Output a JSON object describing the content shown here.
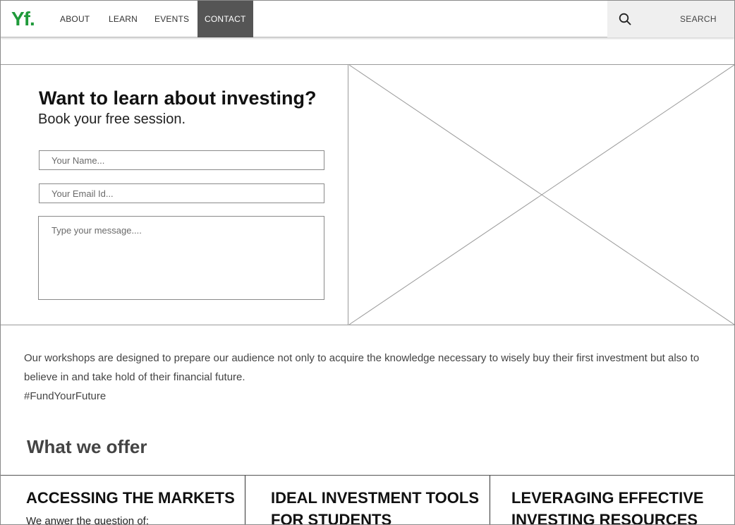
{
  "nav": {
    "logo": "Yf",
    "logo_dot": ".",
    "items": [
      {
        "label": "ABOUT"
      },
      {
        "label": "LEARN"
      },
      {
        "label": "EVENTS"
      },
      {
        "label": "CONTACT"
      }
    ],
    "active": "CONTACT",
    "search_label": "SEARCH"
  },
  "hero": {
    "title": "Want to learn about investing?",
    "subtitle": "Book your free session.",
    "name_placeholder": "Your Name...",
    "email_placeholder": "Your Email Id...",
    "message_placeholder": "Type your message...."
  },
  "description": {
    "text": "Our workshops are designed to prepare our audience not only to acquire the knowledge necessary to wisely buy their first investment but also to believe in and take hold of their financial future.",
    "hashtag": "#FundYourFuture"
  },
  "offer": {
    "title": "What we offer",
    "cards": [
      {
        "title": "ACCESSING THE MARKETS",
        "text": "We anwer the question of:"
      },
      {
        "title": "IDEAL INVESTMENT TOOLS FOR STUDENTS",
        "text": ""
      },
      {
        "title": "LEVERAGING EFFECTIVE INVESTING RESOURCES",
        "text": ""
      }
    ]
  },
  "colors": {
    "brand": "#1f9a3a",
    "active_nav_bg": "#555555",
    "search_bg": "#efefef"
  },
  "icons": {
    "search": "search-icon",
    "placeholder_image": "image-placeholder"
  }
}
